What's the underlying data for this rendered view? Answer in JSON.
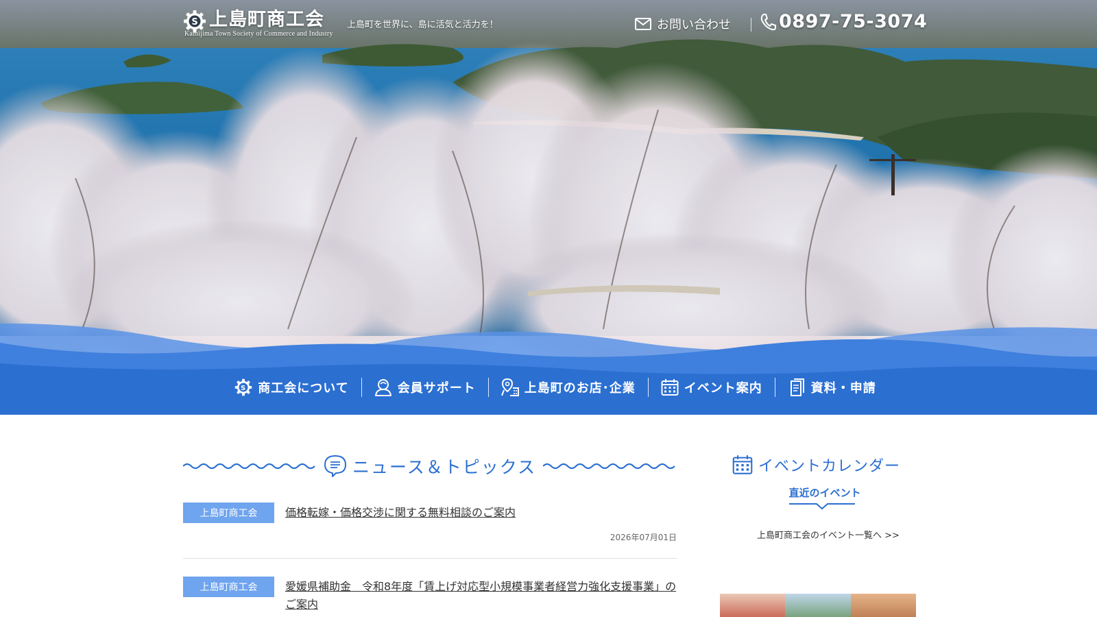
{
  "header": {
    "site_title": "上島町商工会",
    "site_title_en": "Kamijima Town Society of Commerce and Industry",
    "tagline": "上島町を世界に、島に活気と活力を！",
    "contact_label": "お問い合わせ",
    "phone": "0897-75-3074"
  },
  "nav": {
    "items": [
      {
        "label": "商工会について",
        "icon": "logo-mark-icon"
      },
      {
        "label": "会員サポート",
        "icon": "person-icon"
      },
      {
        "label": "上島町のお店･企業",
        "icon": "map-pin-icon"
      },
      {
        "label": "イベント案内",
        "icon": "calendar-icon"
      },
      {
        "label": "資料・申請",
        "icon": "document-icon"
      }
    ]
  },
  "news": {
    "heading": "ニュース＆トピックス",
    "items": [
      {
        "category": "上島町商工会",
        "title": "価格転嫁・価格交渉に関する無料相談のご案内",
        "date": "2026年07月01日"
      },
      {
        "category": "上島町商工会",
        "title": "愛媛県補助金　令和8年度「賃上げ対応型小規模事業者経営力強化支援事業」のご案内",
        "date": ""
      }
    ]
  },
  "sidebar": {
    "calendar_heading": "イベントカレンダー",
    "recent_label": "直近のイベント",
    "event_list_link": "上島町商工会のイベント一覧へ >>"
  },
  "colors": {
    "brand_blue": "#2b6fd1",
    "nav_blue": "#2b6fd1",
    "category_blue": "#6fa4ee"
  }
}
